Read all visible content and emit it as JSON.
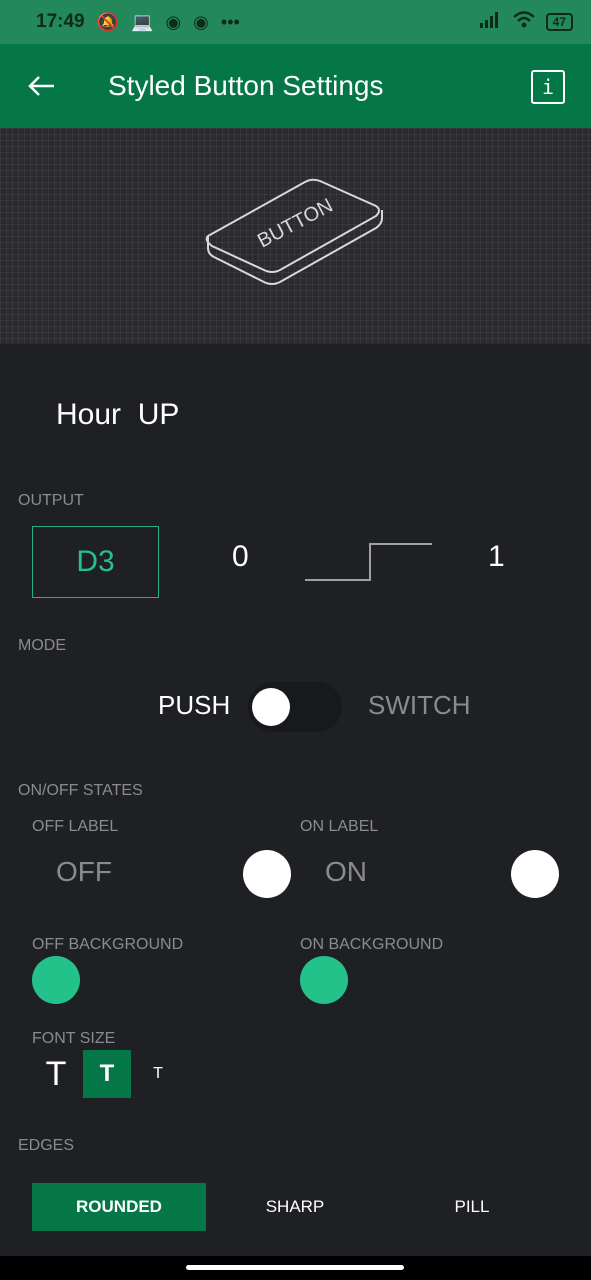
{
  "status_bar": {
    "time": "17:49",
    "icons_left": [
      "mute-icon",
      "laptop-icon",
      "discord-icon",
      "discord-icon",
      "more-dots"
    ],
    "dots": "•••",
    "battery": "47"
  },
  "app_bar": {
    "title": "Styled Button Settings",
    "back_icon": "arrow-left-icon",
    "info_label": "i"
  },
  "preview": {
    "button_text": "BUTTON"
  },
  "widget_name": "Hour  UP",
  "output": {
    "section": "OUTPUT",
    "pin": "D3",
    "low_value": "0",
    "high_value": "1"
  },
  "mode": {
    "section": "MODE",
    "push_label": "PUSH",
    "switch_label": "SWITCH"
  },
  "states": {
    "section": "ON/OFF STATES",
    "off_label_title": "OFF LABEL",
    "off_label_value": "OFF",
    "on_label_title": "ON LABEL",
    "on_label_value": "ON",
    "off_bg_title": "OFF BACKGROUND",
    "on_bg_title": "ON BACKGROUND",
    "off_bg_color": "#23c28a",
    "on_bg_color": "#23c28a"
  },
  "font_size": {
    "section": "FONT SIZE",
    "options": [
      "T",
      "T",
      "T"
    ],
    "selected_index": 1
  },
  "edges": {
    "section": "EDGES",
    "options": [
      "ROUNDED",
      "SHARP",
      "PILL"
    ],
    "selected": "ROUNDED"
  },
  "colors": {
    "accent": "#057646",
    "status": "#23895a",
    "teal": "#23c28a"
  }
}
